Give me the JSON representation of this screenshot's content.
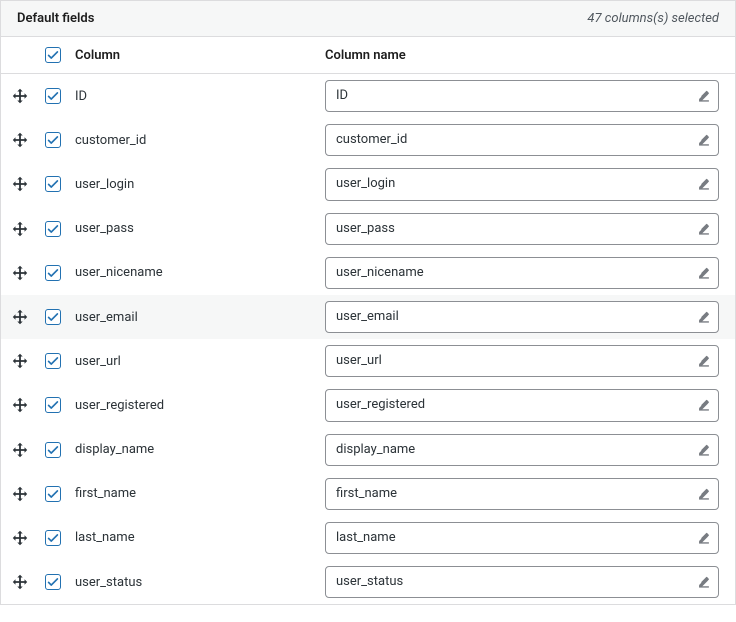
{
  "header": {
    "title": "Default fields",
    "status": "47 columns(s) selected"
  },
  "table": {
    "header_column": "Column",
    "header_name": "Column name",
    "master_checked": true
  },
  "rows": [
    {
      "column": "ID",
      "name": "ID",
      "checked": true,
      "highlighted": false
    },
    {
      "column": "customer_id",
      "name": "customer_id",
      "checked": true,
      "highlighted": false
    },
    {
      "column": "user_login",
      "name": "user_login",
      "checked": true,
      "highlighted": false
    },
    {
      "column": "user_pass",
      "name": "user_pass",
      "checked": true,
      "highlighted": false
    },
    {
      "column": "user_nicename",
      "name": "user_nicename",
      "checked": true,
      "highlighted": false
    },
    {
      "column": "user_email",
      "name": "user_email",
      "checked": true,
      "highlighted": true
    },
    {
      "column": "user_url",
      "name": "user_url",
      "checked": true,
      "highlighted": false
    },
    {
      "column": "user_registered",
      "name": "user_registered",
      "checked": true,
      "highlighted": false
    },
    {
      "column": "display_name",
      "name": "display_name",
      "checked": true,
      "highlighted": false
    },
    {
      "column": "first_name",
      "name": "first_name",
      "checked": true,
      "highlighted": false
    },
    {
      "column": "last_name",
      "name": "last_name",
      "checked": true,
      "highlighted": false
    },
    {
      "column": "user_status",
      "name": "user_status",
      "checked": true,
      "highlighted": false
    }
  ]
}
